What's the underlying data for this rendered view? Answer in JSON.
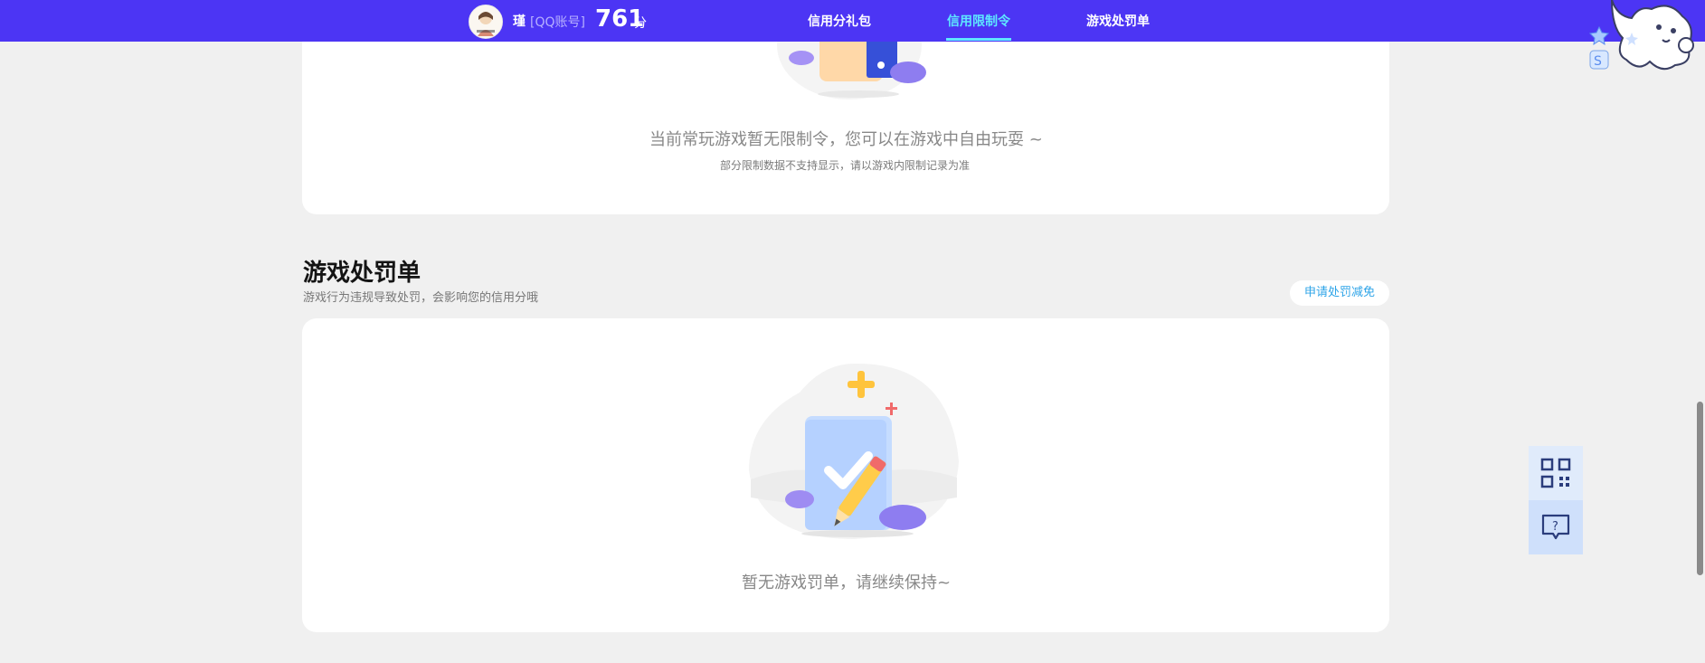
{
  "header": {
    "user_name": "瑾",
    "account_type": "[QQ账号]",
    "score": "761",
    "score_unit": "分",
    "nav": [
      {
        "label": "信用分礼包",
        "active": false
      },
      {
        "label": "信用限制令",
        "active": true
      },
      {
        "label": "游戏处罚单",
        "active": false
      }
    ]
  },
  "restriction": {
    "empty_text": "当前常玩游戏暂无限制令，您可以在游戏中自由玩耍 ~",
    "note": "部分限制数据不支持显示，请以游戏内限制记录为准"
  },
  "penalty": {
    "title": "游戏处罚单",
    "subtitle": "游戏行为违规导致处罚，会影响您的信用分哦",
    "apply_button": "申请处罚减免",
    "empty_text": "暂无游戏罚单，请继续保持~"
  },
  "float_panel": {
    "items": [
      "qr-code-icon",
      "help-question-icon"
    ]
  },
  "colors": {
    "nav_bg": "#4c35f4",
    "active_nav": "#5ee7ff",
    "link_blue": "#2ea4e8"
  }
}
